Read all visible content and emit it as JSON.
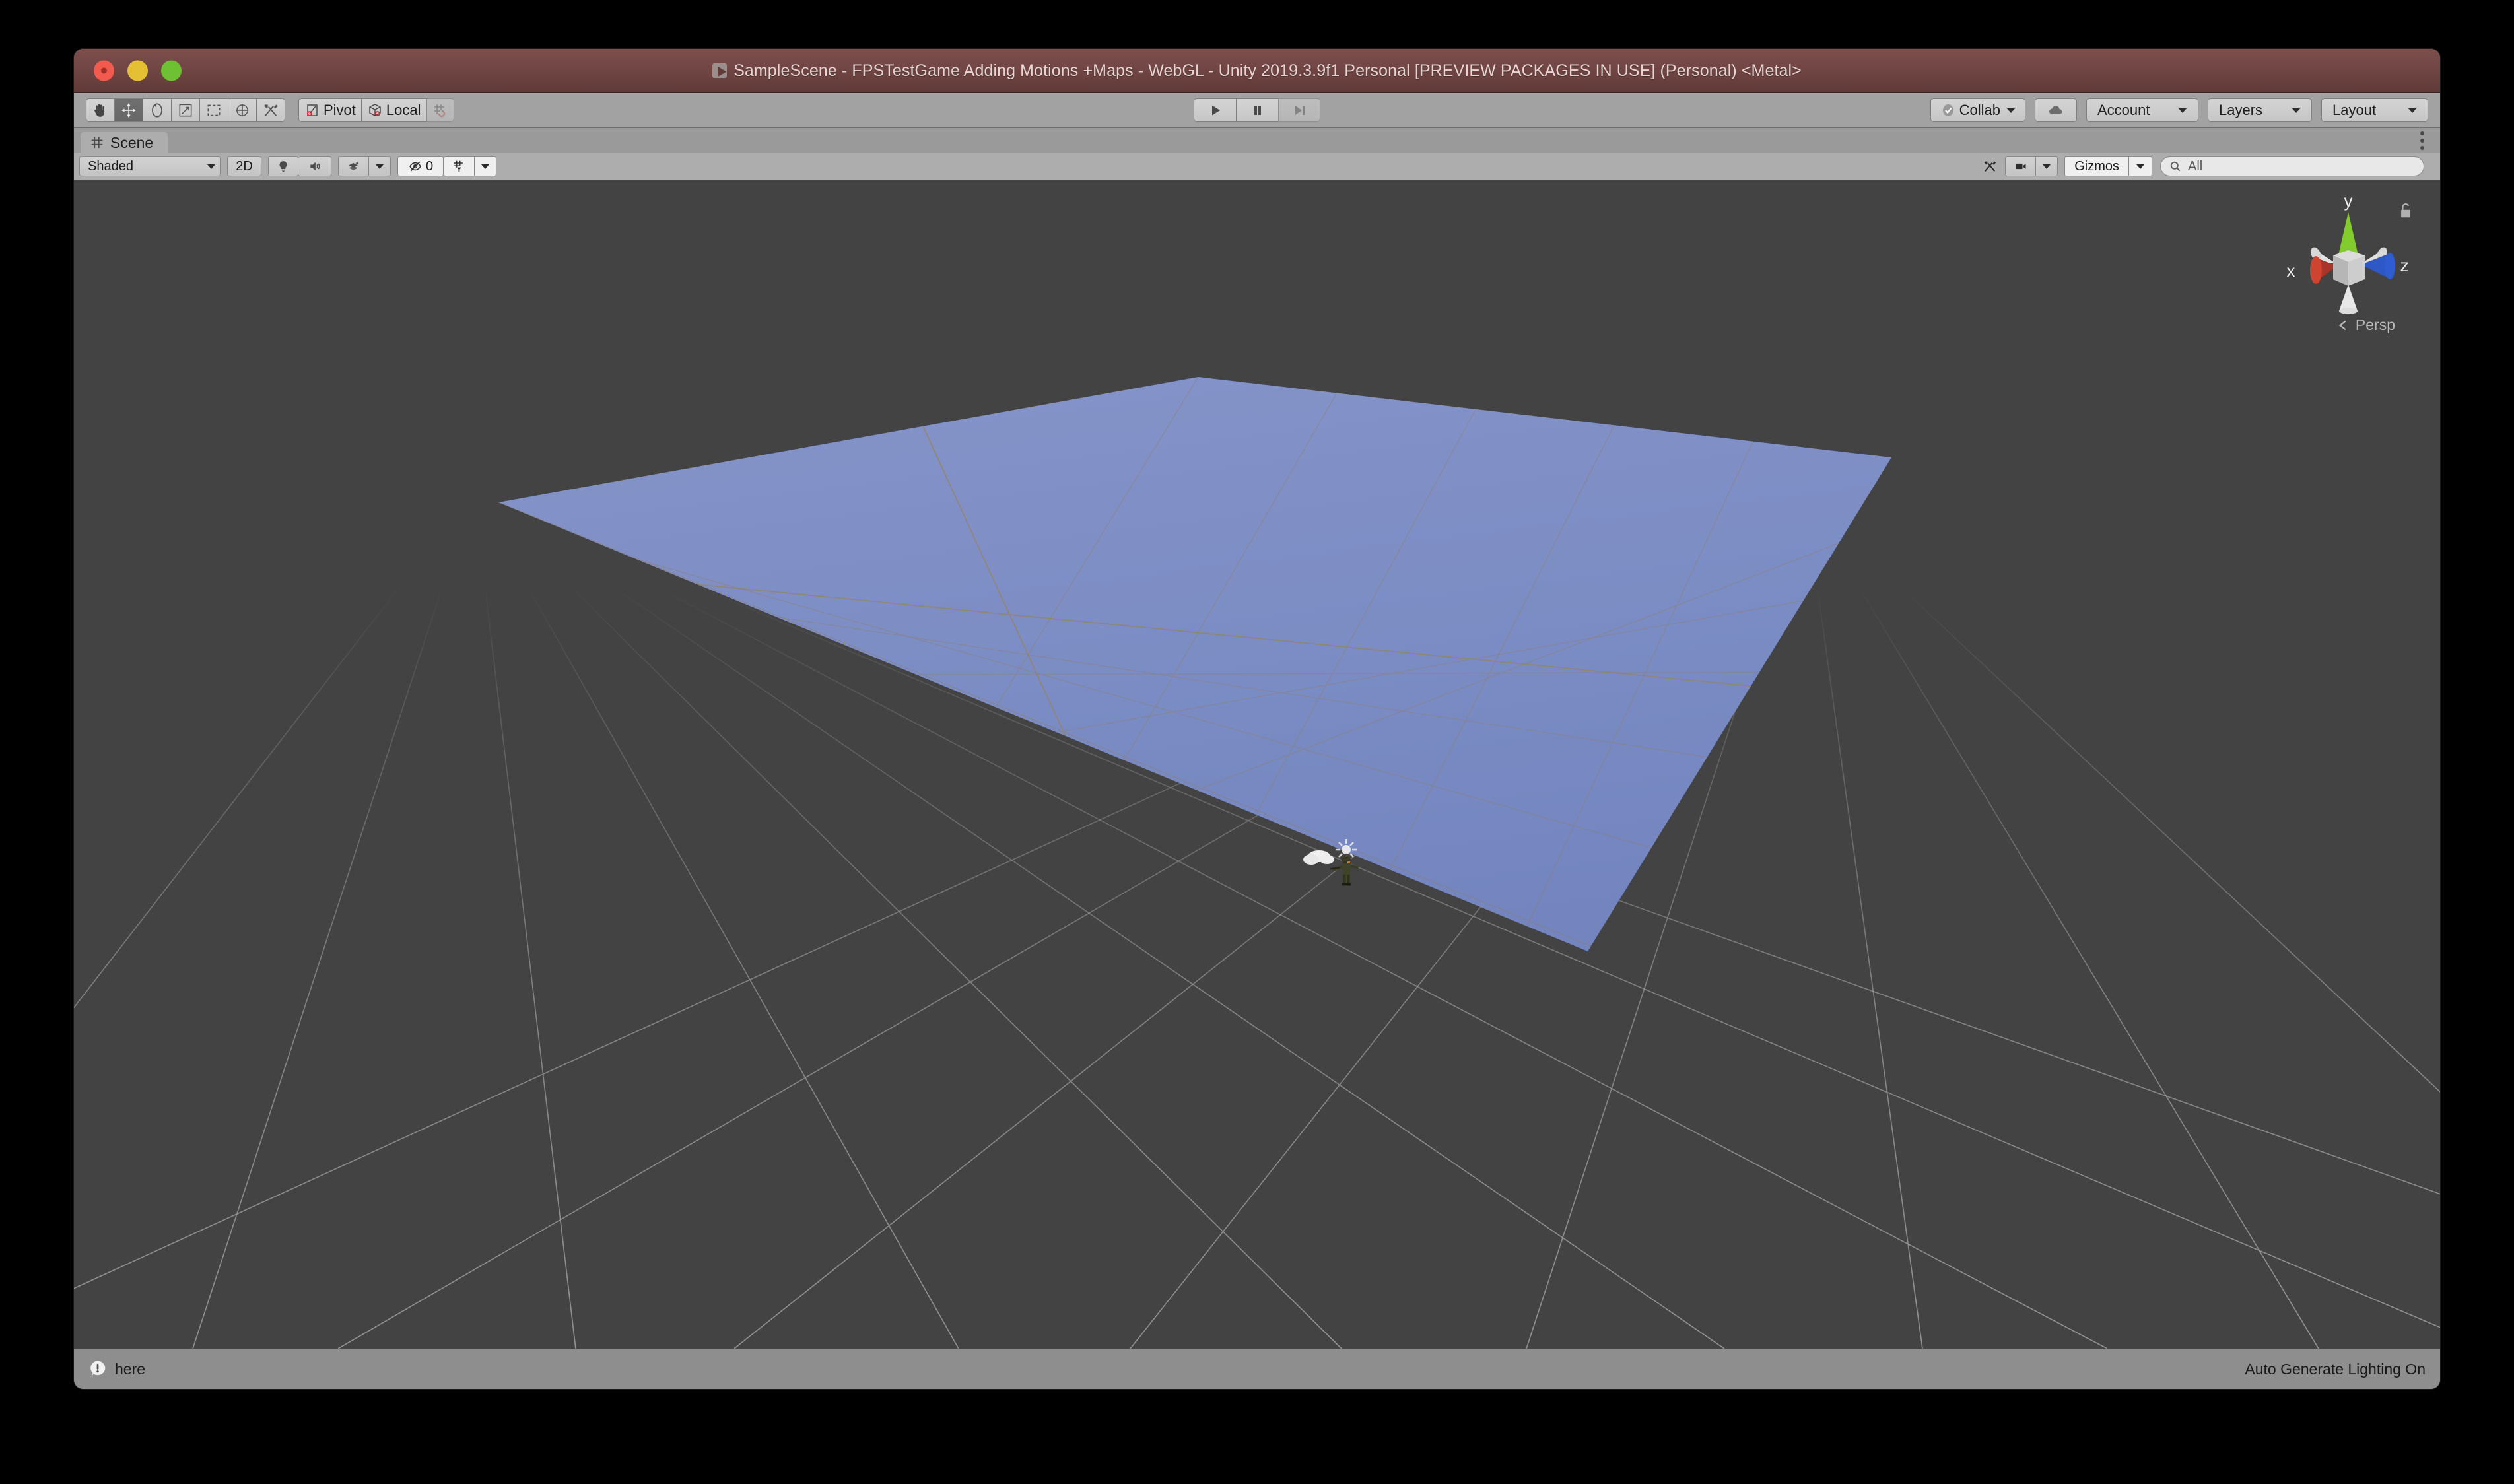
{
  "window": {
    "title": "SampleScene - FPSTestGame Adding Motions +Maps - WebGL - Unity 2019.3.9f1 Personal [PREVIEW PACKAGES IN USE] (Personal) <Metal>",
    "traffic_lights": [
      "close-button",
      "minimize-button",
      "maximize-button"
    ]
  },
  "toolbar": {
    "transform_tools": [
      {
        "name": "hand-tool",
        "icon": "hand-icon",
        "active": false
      },
      {
        "name": "move-tool",
        "icon": "move-icon",
        "active": true
      },
      {
        "name": "rotate-tool",
        "icon": "rotate-icon",
        "active": false
      },
      {
        "name": "scale-tool",
        "icon": "scale-icon",
        "active": false
      },
      {
        "name": "rect-tool",
        "icon": "rect-icon",
        "active": false
      },
      {
        "name": "transform-tool",
        "icon": "transform-icon",
        "active": false
      },
      {
        "name": "custom-editor-tool",
        "icon": "wrench-hammer-icon",
        "active": false
      }
    ],
    "pivot_label": "Pivot",
    "handle_space_label": "Local",
    "grid_snap_label": "",
    "play_label": "",
    "pause_label": "",
    "step_label": "",
    "collab_label": "Collab",
    "cloud_label": "",
    "account_label": "Account",
    "layers_label": "Layers",
    "layout_label": "Layout"
  },
  "tabs": {
    "scene_label": "Scene"
  },
  "scene_toolbar": {
    "draw_mode": "Shaded",
    "two_d_label": "2D",
    "lighting_icon": "light-bulb-icon",
    "audio_icon": "speaker-icon",
    "effects_icon": "fx-layers-icon",
    "hidden_count": "0",
    "hidden_icon": "eye-off-icon",
    "grid_icon": "grid-y-icon",
    "tools_icon": "wrench-hammer-icon",
    "camera_icon": "camera-icon",
    "gizmos_label": "Gizmos",
    "search_placeholder": "All",
    "search_value": ""
  },
  "scene_gizmo": {
    "axis_x": "x",
    "axis_y": "y",
    "axis_z": "z",
    "projection": "Persp",
    "lock_icon": "lock-icon",
    "colors": {
      "x": "#c1392b",
      "y": "#82cc2e",
      "z": "#2d58c6",
      "center": "#c9c9c9"
    }
  },
  "viewport": {
    "background_color": "#434343",
    "grid_color": "#9d9d9d",
    "plane_color": "#7b8cc4",
    "plane_name": "Plane",
    "character_name": "fps-character",
    "light_gizmo_name": "point-light-gizmo",
    "cloud_name": "cloud-object"
  },
  "statusbar": {
    "message": "here",
    "message_icon": "warning-bubble-icon",
    "lighting_status": "Auto Generate Lighting On"
  }
}
